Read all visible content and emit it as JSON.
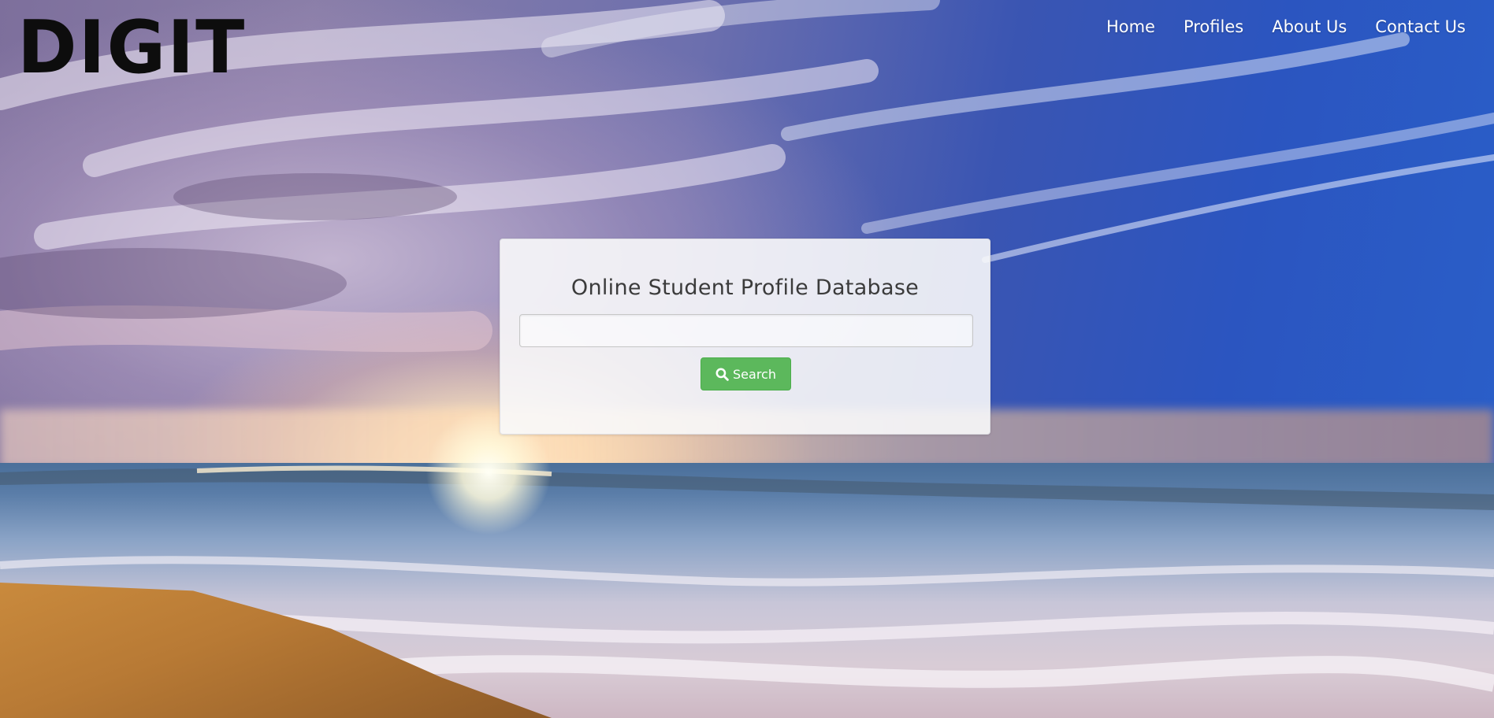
{
  "header": {
    "logo_text": "DIGIT",
    "nav": [
      {
        "label": "Home"
      },
      {
        "label": "Profiles"
      },
      {
        "label": "About Us"
      },
      {
        "label": "Contact Us"
      }
    ]
  },
  "search_card": {
    "title": "Online Student Profile Database",
    "input_value": "",
    "input_placeholder": "",
    "button_label": "Search",
    "button_icon": "search-icon"
  },
  "colors": {
    "button": "#5cb85c",
    "nav_text": "#ffffff",
    "logo": "#0d0d0d"
  }
}
